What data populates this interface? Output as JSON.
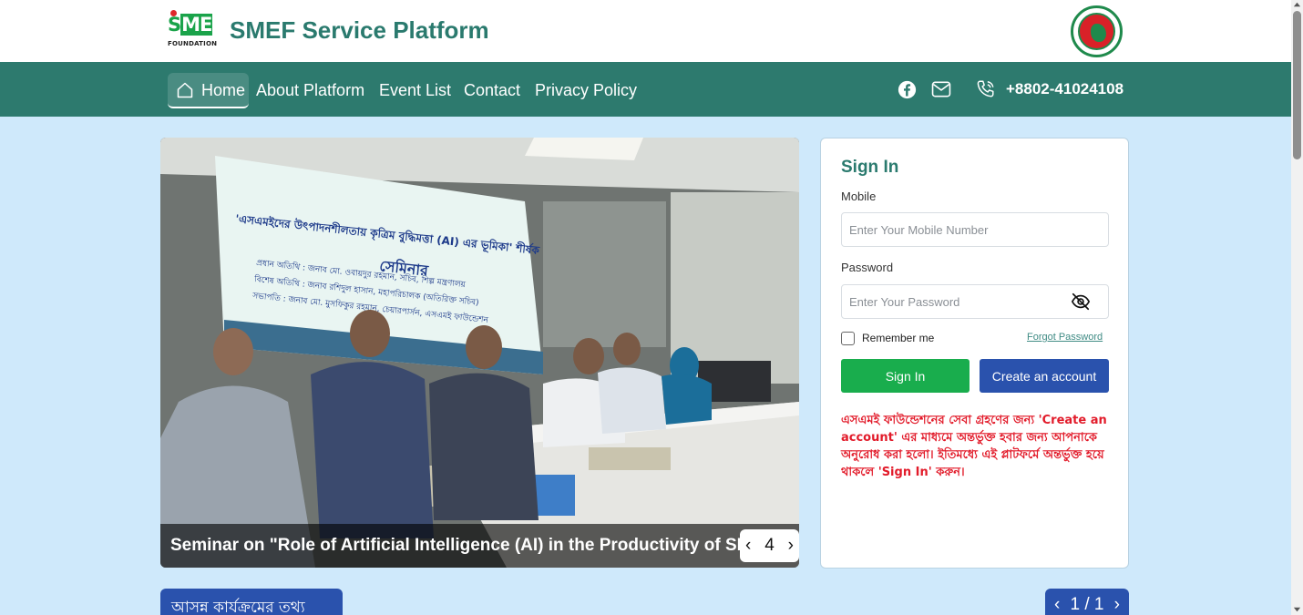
{
  "header": {
    "logo_text_s": "S",
    "logo_text_me": "ME",
    "logo_subtext": "FOUNDATION",
    "title": "SMEF Service Platform"
  },
  "nav": {
    "items": [
      {
        "label": "Home",
        "icon": "home-icon",
        "active": true
      },
      {
        "label": "About Platform"
      },
      {
        "label": "Event List"
      },
      {
        "label": "Contact"
      },
      {
        "label": "Privacy Policy"
      }
    ],
    "social": [
      "facebook-icon",
      "mail-icon",
      "phone-icon"
    ],
    "phone": "+8802-41024108"
  },
  "hero": {
    "caption": "Seminar on \"Role of Artificial Intelligence (AI) in the Productivity of SMEs\"",
    "prev": "‹",
    "slide_number": "4",
    "next": "›",
    "banner_title": "'এসএমইদের উৎপাদনশীলতায় কৃত্রিম বুদ্ধিমত্তা (AI) এর ভূমিকা' শীর্ষক",
    "banner_subtitle": "সেমিনার",
    "banner_lines": [
      "প্রধান অতিথি :  জনাব মো. ওবায়দুর রহমান, সচিব, শিল্প মন্ত্রণালয়",
      "বিশেষ অতিথি :  জনাব রশিদুল হাসান, মহাপরিচালক (অতিরিক্ত সচিব)",
      "সভাপতি       :  জনাব মো. মুসফিকুর রহমান, চেয়ারপার্সন, এসএমই ফাউন্ডেশন"
    ]
  },
  "signin": {
    "title": "Sign In",
    "mobile_label": "Mobile",
    "mobile_placeholder": "Enter Your Mobile Number",
    "password_label": "Password",
    "password_placeholder": "Enter Your Password",
    "remember_label": "Remember me",
    "forgot_label": "Forgot Password",
    "signin_button": "Sign In",
    "create_button": "Create an account",
    "notice": "এসএমই ফাউন্ডেশনের সেবা গ্রহণের জন্য 'Create an account' এর মাধ্যমে অন্তর্ভুক্ত হবার জন্য আপনাকে অনুরোধ করা হলো। ইতিমধ্যে এই প্লাটফর্মে অন্তর্ভুক্ত হয়ে থাকলে 'Sign In' করুন।"
  },
  "upcoming": {
    "title": "আসন্ন কার্যক্রমের তথ্য",
    "pager_prev": "‹",
    "pager_text": "1 / 1",
    "pager_next": "›"
  },
  "colors": {
    "brand_green": "#2a7a6e",
    "nav_bg": "#2d7a6e",
    "page_bg": "#cfe9fb",
    "signin_btn": "#19ad4d",
    "create_btn": "#2a52ad",
    "notice_red": "#e21b2a"
  }
}
